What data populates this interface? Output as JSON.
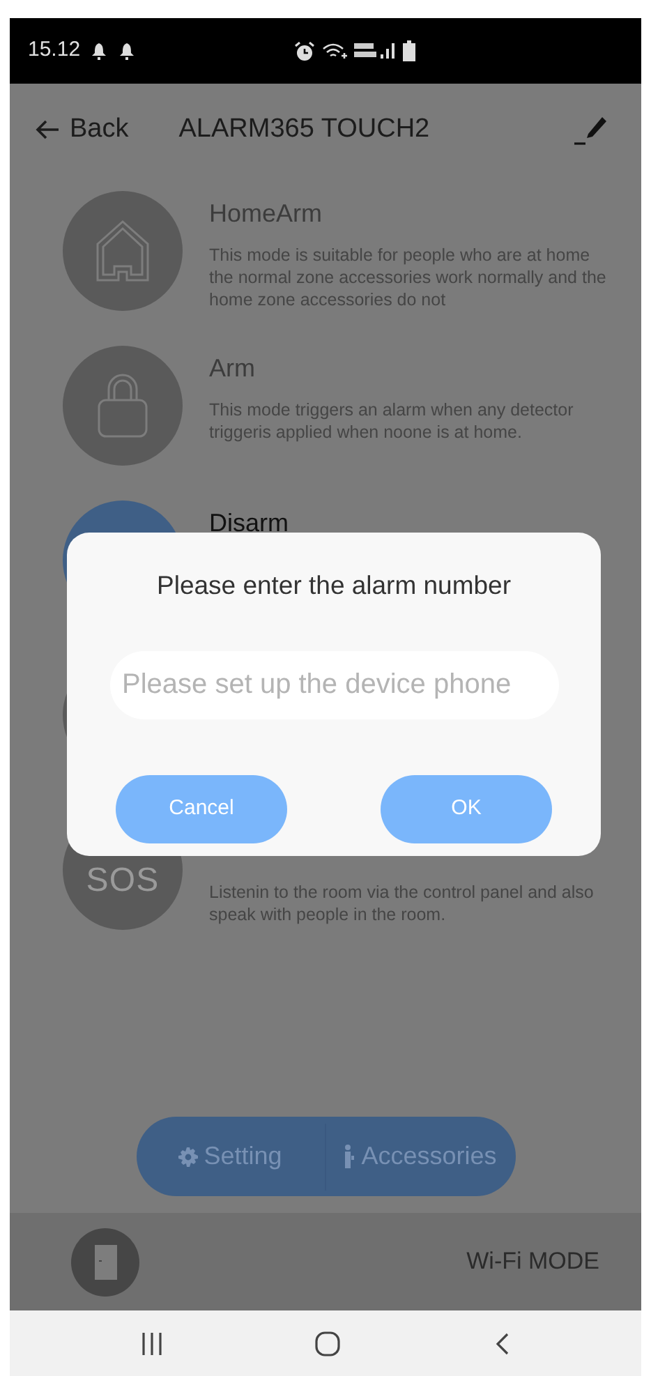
{
  "status_bar": {
    "time": "15.12"
  },
  "header": {
    "back_label": "Back",
    "title": "ALARM365 TOUCH2"
  },
  "modes": [
    {
      "kind": "home",
      "selected": false,
      "title": "HomeArm",
      "description": "This mode is suitable for people who are at home the normal zone accessories work normally and the home zone accessories do not"
    },
    {
      "kind": "lock",
      "selected": false,
      "title": "Arm",
      "description": "This mode triggers an alarm when any detector triggeris applied when noone is at home."
    },
    {
      "kind": "disarm",
      "selected": true,
      "title": "Disarm"
    },
    {
      "kind": "blank",
      "selected": false
    },
    {
      "kind": "sos",
      "selected": false,
      "icon_text": "SOS",
      "description": "Listenin to the room via the control panel and also speak with people in the room."
    }
  ],
  "dialog": {
    "title": "Please enter the alarm number",
    "field": {
      "placeholder": "Please set up the device phone"
    },
    "buttons": [
      "Cancel",
      "OK"
    ]
  },
  "bottom_menu": [
    {
      "kind": "setting",
      "label": "Setting"
    },
    {
      "kind": "accessories",
      "label": "Accessories"
    }
  ],
  "footer": {
    "mode_label": "Wi-Fi MODE"
  }
}
